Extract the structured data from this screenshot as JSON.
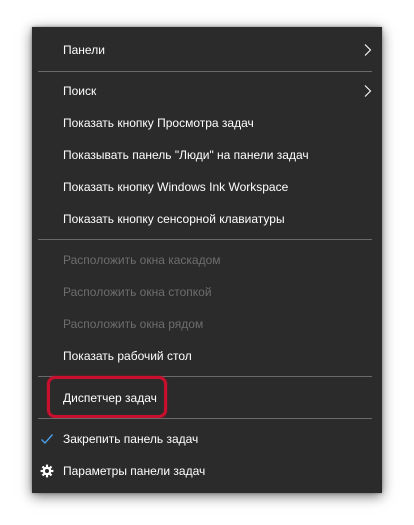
{
  "context_menu": {
    "items": [
      {
        "label": "Панели",
        "icon": "chevron-right-icon"
      },
      {
        "label": "Поиск",
        "icon": "chevron-right-icon"
      },
      {
        "label": "Показать кнопку Просмотра задач"
      },
      {
        "label": "Показывать панель \"Люди\" на панели задач"
      },
      {
        "label": "Показать кнопку Windows Ink Workspace"
      },
      {
        "label": "Показать кнопку сенсорной клавиатуры"
      },
      {
        "label": "Расположить окна каскадом",
        "state": "disabled"
      },
      {
        "label": "Расположить окна стопкой",
        "state": "disabled"
      },
      {
        "label": "Расположить окна рядом",
        "state": "disabled"
      },
      {
        "label": "Показать рабочий стол"
      },
      {
        "label": "Диспетчер задач",
        "state": "highlighted"
      },
      {
        "label": "Закрепить панель задач",
        "icon": "checkmark-icon",
        "state": "checked"
      },
      {
        "label": "Параметры панели задач",
        "icon": "gear-icon"
      }
    ]
  },
  "colors": {
    "menu_background": "#2b2b2b",
    "text": "#ffffff",
    "disabled_text": "#6d6d6d",
    "separator": "#6a6a6a",
    "checkmark": "#4a9ee8",
    "highlight_ring": "#c8102e"
  }
}
